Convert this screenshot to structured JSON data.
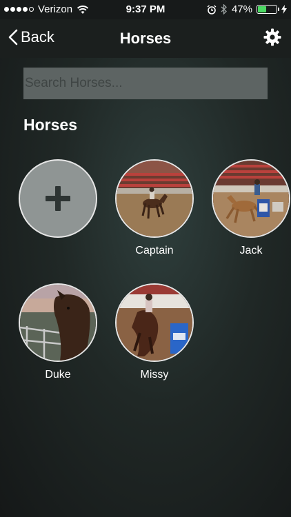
{
  "status": {
    "carrier": "Verizon",
    "time": "9:37 PM",
    "battery_percent": "47%",
    "battery_level": 0.47
  },
  "nav": {
    "back_label": "Back",
    "title": "Horses"
  },
  "search": {
    "placeholder": "Search Horses..."
  },
  "section_title": "Horses",
  "horses": [
    {
      "name": "Captain"
    },
    {
      "name": "Jack"
    },
    {
      "name": "Duke"
    },
    {
      "name": "Missy"
    }
  ],
  "colors": {
    "battery_green": "#4cd964",
    "add_circle_bg": "#8f9594",
    "search_bg": "#5d6463"
  }
}
